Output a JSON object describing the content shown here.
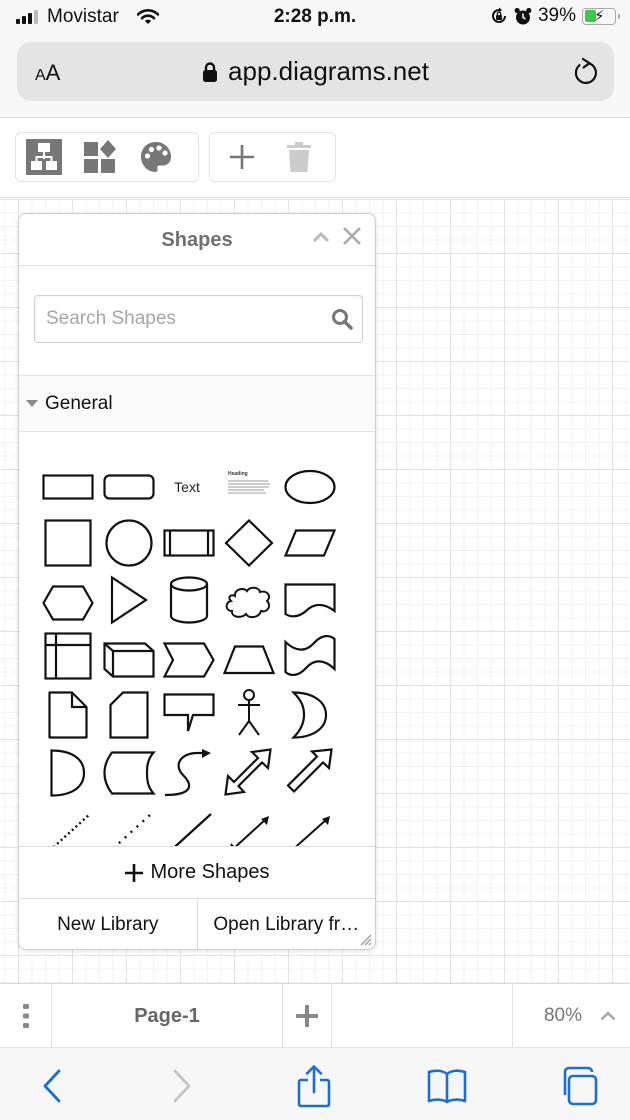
{
  "status_bar": {
    "carrier": "Movistar",
    "time": "2:28 p.m.",
    "battery_percent": "39%",
    "battery_level": 0.39,
    "icons": [
      "signal-icon",
      "wifi-icon",
      "orientation-lock-icon",
      "alarm-icon",
      "battery-charging-icon"
    ]
  },
  "browser": {
    "text_size_label": "AA",
    "url": "app.diagrams.net",
    "icons": [
      "lock-icon",
      "reload-icon"
    ]
  },
  "toolbar": {
    "groups": [
      {
        "buttons": [
          {
            "name": "format-panel-button",
            "icon": "diagram-icon"
          },
          {
            "name": "shapes-button",
            "icon": "shapes-icon"
          },
          {
            "name": "style-button",
            "icon": "palette-icon"
          }
        ]
      },
      {
        "buttons": [
          {
            "name": "insert-button",
            "icon": "plus-icon"
          },
          {
            "name": "delete-button",
            "icon": "trash-icon",
            "disabled": true
          }
        ]
      }
    ]
  },
  "shapes_panel": {
    "title": "Shapes",
    "search_placeholder": "Search Shapes",
    "search_value": "",
    "section": {
      "label": "General",
      "expanded": true,
      "shapes": [
        "rectangle",
        "rounded-rectangle",
        "text",
        "textbox",
        "ellipse",
        "square",
        "circle",
        "process",
        "diamond",
        "parallelogram",
        "hexagon",
        "triangle",
        "cylinder",
        "cloud",
        "document",
        "internal-storage",
        "cube",
        "step",
        "trapezoid",
        "tape",
        "note",
        "card",
        "callout",
        "actor",
        "or",
        "and",
        "data-storage",
        "curved-arrow",
        "bidirectional-arrow",
        "arrow",
        "dashed-line",
        "dotted-line",
        "line",
        "bidirectional-connector",
        "directional-connector"
      ],
      "text_shape_label": "Text",
      "textbox_heading": "Heading"
    },
    "more_shapes_label": "More Shapes",
    "new_library_label": "New Library",
    "open_library_label": "Open Library fr…"
  },
  "page_bar": {
    "page_name": "Page-1",
    "zoom": "80%"
  },
  "safari_bar": {
    "buttons": [
      "back",
      "forward",
      "share",
      "bookmarks",
      "tabs"
    ],
    "accent_color": "#1a6fd1"
  }
}
